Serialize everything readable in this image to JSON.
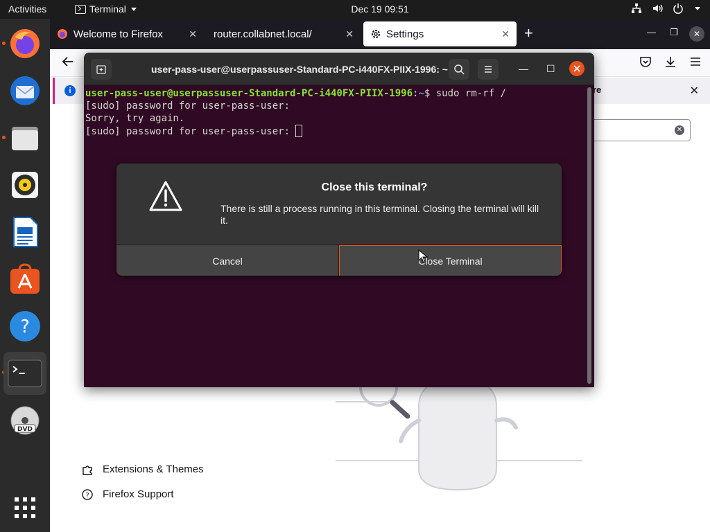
{
  "topbar": {
    "activities": "Activities",
    "app_name": "Terminal",
    "clock": "Dec 19  09:51",
    "tray_icons": [
      "network-icon",
      "volume-icon",
      "power-icon",
      "menu-caret-icon"
    ]
  },
  "dock": {
    "items": [
      {
        "name": "firefox",
        "running": true
      },
      {
        "name": "thunderbird",
        "running": false
      },
      {
        "name": "files",
        "running": true
      },
      {
        "name": "rhythmbox",
        "running": false
      },
      {
        "name": "libreoffice-writer",
        "running": false
      },
      {
        "name": "ubuntu-software",
        "running": false
      },
      {
        "name": "help",
        "running": false
      },
      {
        "name": "terminal",
        "running": true,
        "active": true
      },
      {
        "name": "dvd",
        "running": false
      },
      {
        "name": "show-applications",
        "running": false
      }
    ],
    "accent": "#e95420"
  },
  "firefox": {
    "tabs": [
      {
        "label": "Welcome to Firefox"
      },
      {
        "label": "router.collabnet.local/"
      },
      {
        "label": "Settings",
        "selected": true
      }
    ],
    "notice_more": "re",
    "menu_links": [
      {
        "label": "Extensions & Themes",
        "icon": "puzzle-icon"
      },
      {
        "label": "Firefox Support",
        "icon": "help-circle-icon"
      }
    ]
  },
  "terminal": {
    "title": "user-pass-user@userpassuser-Standard-PC-i440FX-PIIX-1996: ~",
    "lines": {
      "prompt_user": "user-pass-user@userpassuser-Standard-PC-i440FX-PIIX-1996",
      "prompt_path": "~",
      "command": "$ sudo rm-rf /",
      "line2": "[sudo] password for user-pass-user:",
      "line3": "Sorry, try again.",
      "line4": "[sudo] password for user-pass-user: "
    }
  },
  "dialog": {
    "title": "Close this terminal?",
    "message": "There is still a process running in this terminal. Closing the terminal will kill it.",
    "cancel_label": "Cancel",
    "close_label": "Close Terminal",
    "accent": "#e95420"
  }
}
